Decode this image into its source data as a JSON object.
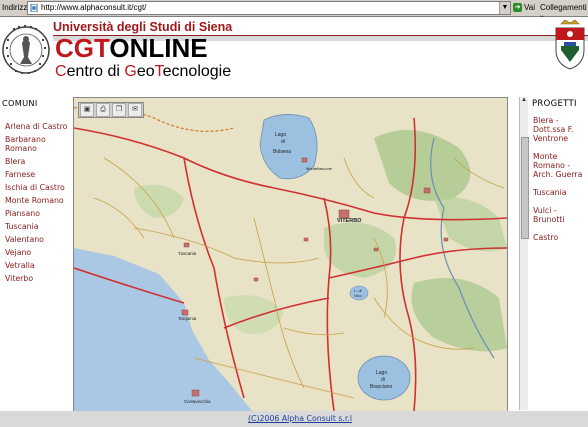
{
  "browser": {
    "address_label": "Indirizzo",
    "url": "http://www.alphaconsult.it/cgt/",
    "go_label": "Vai",
    "links_label": "Collegamenti"
  },
  "header": {
    "university": "Università degli Studi di Siena",
    "title_red": "CGT",
    "title_black": "ONLINE",
    "subtitle_parts": [
      "C",
      "entro di ",
      "G",
      "eo",
      "T",
      "ecnologie"
    ]
  },
  "left_sidebar": {
    "heading": "COMUNI",
    "items": [
      "Arlena di Castro",
      "Barbarano Romano",
      "Blera",
      "Farnese",
      "Ischia di Castro",
      "Monte Romano",
      "Piansano",
      "Tuscania",
      "Valentano",
      "Vejano",
      "Vetralla",
      "Viterbo"
    ]
  },
  "right_sidebar": {
    "heading": "PROGETTI",
    "items": [
      "Blera - Dott.ssa F. Ventrone",
      "Monte Romano - Arch. Guerra",
      "Tuscania",
      "Vulci - Brunotti",
      "Castro"
    ]
  },
  "map": {
    "tools": [
      "save-icon",
      "print-icon",
      "copy-icon",
      "email-icon"
    ],
    "labels": {
      "lake_bolsena_1": "Lago",
      "lake_bolsena_2": "di",
      "lake_bolsena_3": "Bolsena",
      "viterbo": "VITERBO",
      "tuscania": "Tuscania",
      "tarquinia": "Tarquinia",
      "civitavecchia": "Civitavecchia",
      "lake_bracciano_1": "Lago",
      "lake_bracciano_2": "di",
      "lake_bracciano_3": "Bracciano",
      "vico_1": "L. di",
      "vico_2": "Vico",
      "montefiascone": "Montefiascone"
    },
    "colors": {
      "land": "#e8e2c6",
      "sea": "#aac8e4",
      "lake": "#9cc0e0",
      "forest": "#a9c88c",
      "road": "#d03030",
      "minor_road": "#c8a046"
    }
  },
  "footer": {
    "copyright": "(C)2006 Alpha Consult s.r.l"
  }
}
